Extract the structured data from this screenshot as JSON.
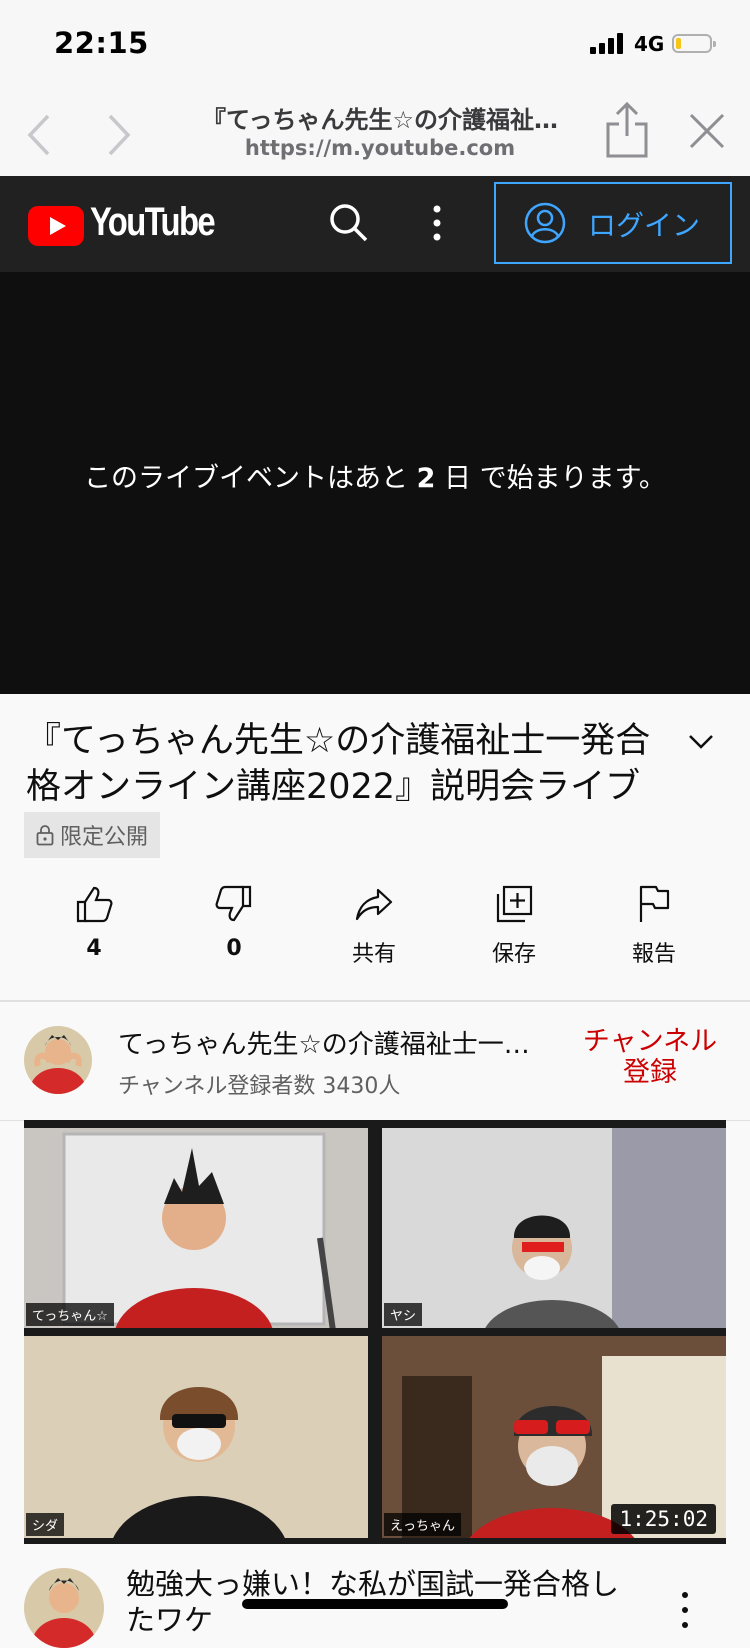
{
  "status_bar": {
    "time": "22:15",
    "network": "4G"
  },
  "browser": {
    "page_title": "『てっちゃん先生☆の介護福祉…",
    "url": "https://m.youtube.com"
  },
  "youtube": {
    "logo_text": "YouTube",
    "login_label": "ログイン",
    "brand_color": "#ff0000"
  },
  "player": {
    "message_before": "このライブイベントはあと ",
    "message_days": "2",
    "message_after": " 日 で始まります。"
  },
  "video": {
    "title": "『てっちゃん先生☆の介護福祉士一発合格オンライン講座2022』説明会ライブ",
    "visibility": "限定公開"
  },
  "actions": {
    "like_count": "4",
    "dislike_count": "0",
    "share_label": "共有",
    "save_label": "保存",
    "report_label": "報告"
  },
  "channel": {
    "name": "てっちゃん先生☆の介護福祉士一…",
    "subscribers": "チャンネル登録者数 3430人",
    "subscribe_label": "チャンネル\n登録"
  },
  "thumbnail": {
    "tiles": [
      "てっちゃん☆",
      "ヤシ",
      "シダ",
      "えっちゃん"
    ],
    "duration": "1:25:02"
  },
  "next_video": {
    "title": "勉強大っ嫌い！な私が国試一発合格したワケ"
  }
}
